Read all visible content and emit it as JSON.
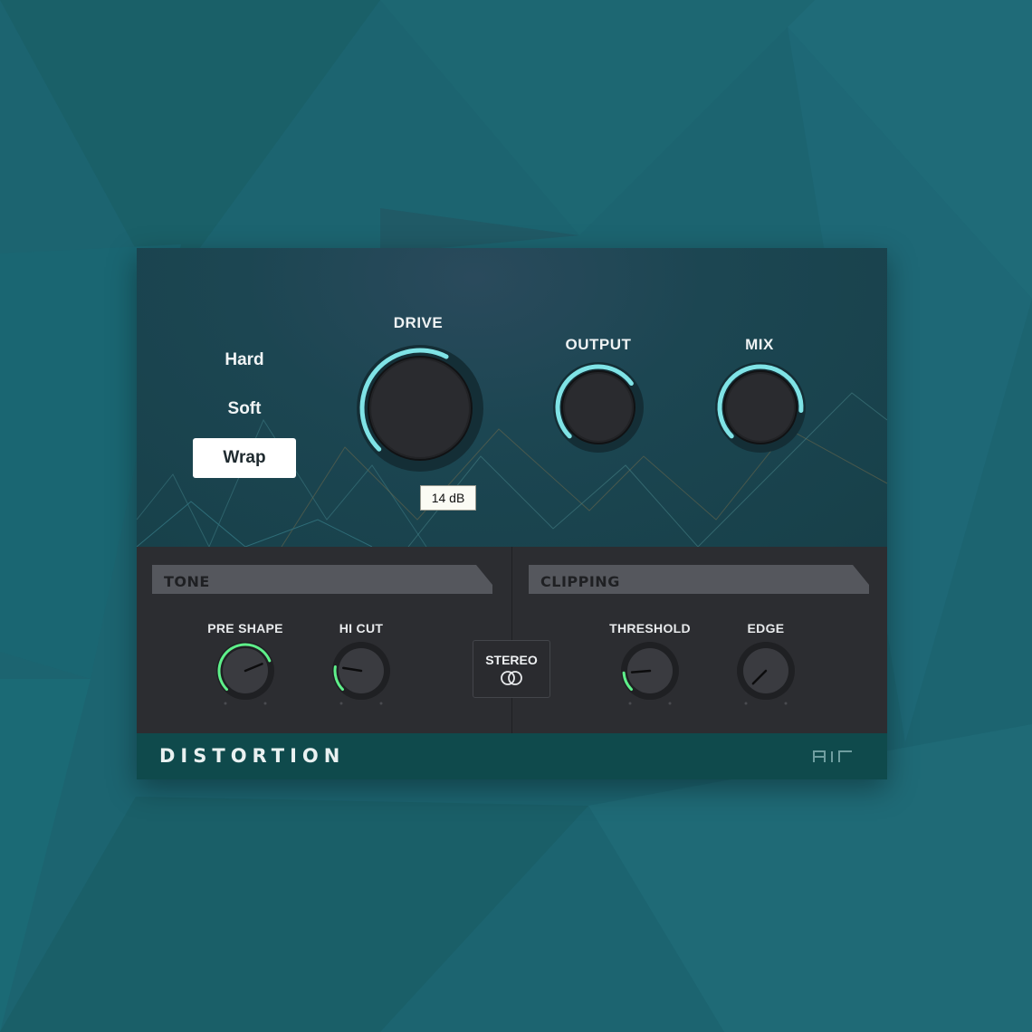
{
  "modes": [
    {
      "label": "Hard",
      "active": false
    },
    {
      "label": "Soft",
      "active": false
    },
    {
      "label": "Wrap",
      "active": true
    }
  ],
  "drive": {
    "label": "DRIVE",
    "tooltip": "14 dB",
    "value": 0.6
  },
  "output": {
    "label": "OUTPUT",
    "value": 0.7
  },
  "mix": {
    "label": "MIX",
    "value": 0.85
  },
  "tone": {
    "title": "TONE",
    "pre_shape": {
      "label": "PRE SHAPE",
      "value": 0.75
    },
    "hi_cut": {
      "label": "HI CUT",
      "value": 0.2
    }
  },
  "stereo": {
    "label": "STEREO",
    "icon": "stereo-link-icon"
  },
  "clipping": {
    "title": "CLIPPING",
    "threshold": {
      "label": "THRESHOLD",
      "value": 0.15
    },
    "edge": {
      "label": "EDGE",
      "value": 0.0
    }
  },
  "footer": {
    "title": "DISTORTION",
    "logo": "air"
  },
  "colors": {
    "accent_cyan": "#7fe3e6",
    "accent_green": "#5ef08a",
    "background": "#1c6470",
    "panel": "#2c2d31",
    "footer": "#0f4a4c"
  }
}
